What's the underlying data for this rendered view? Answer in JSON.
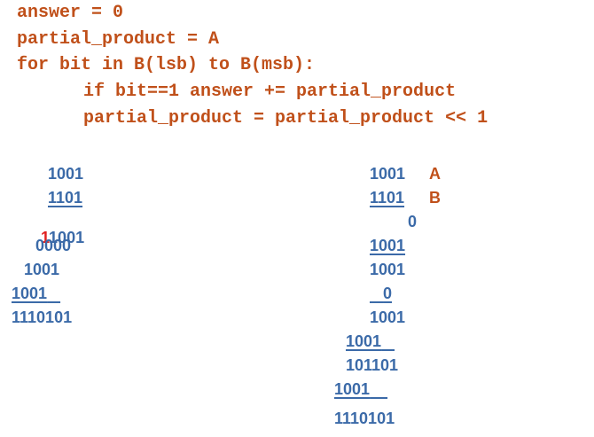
{
  "colors": {
    "code": "#c0501a",
    "numbers": "#3b6aa8",
    "carry": "#e02020",
    "label": "#c0501a"
  },
  "code": {
    "line1": "answer = 0",
    "line2": "partial_product = A",
    "line3": "for bit in B(lsb) to B(msb):",
    "line4": "if bit==1 answer += partial_product",
    "line5": "partial_product = partial_product << 1"
  },
  "left_example": {
    "row1": "1001",
    "row2": "1101",
    "row3_carry": "1",
    "row3_rest": "1001",
    "row4": "0000",
    "row5": "1001",
    "row6": "1001",
    "row6_pad": "   ",
    "row7": "1110101"
  },
  "right_example": {
    "row1": "1001",
    "label_a": "A",
    "row2": "1101",
    "label_b": "B",
    "row3": "0",
    "row4": "1001",
    "row5": "1001",
    "row6_pad": "   ",
    "row6": "0",
    "row7": "1001",
    "row8": "1001",
    "row8_pad": "   ",
    "row9": "101101",
    "row10": "1001",
    "row10_pad": "    ",
    "row11": "1110101"
  }
}
